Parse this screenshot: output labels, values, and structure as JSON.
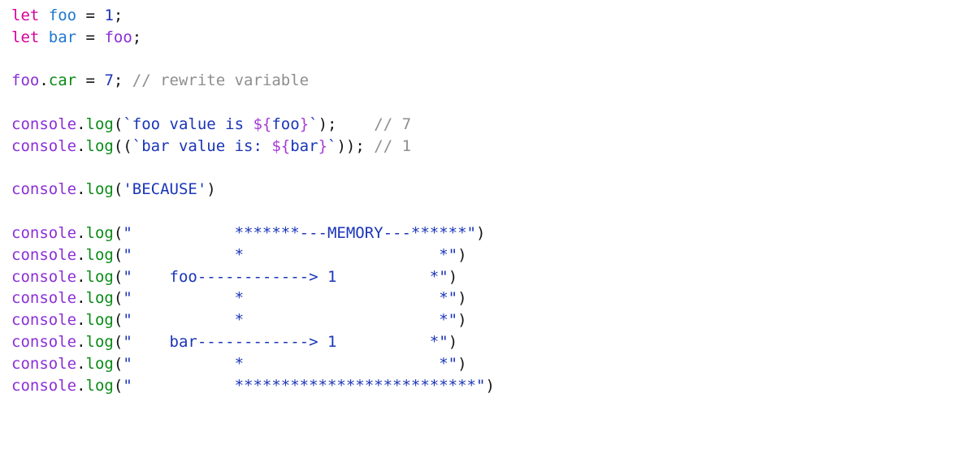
{
  "editor": {
    "background_color": "#ffffff",
    "font_size_px": 19,
    "line_height_px": 26.8
  },
  "palette": {
    "keyword": "#d6009a",
    "declared_variable": "#1f78d1",
    "object": "#8b2fd6",
    "method": "#0a8a16",
    "property": "#0a8a16",
    "string": "#1a35b8",
    "number": "#1a35b8",
    "comment": "#8e8e8e",
    "punctuation": "#141414",
    "interpolation": "#a83bd6"
  },
  "code": {
    "language": "javascript",
    "lines": [
      {
        "index": 1,
        "text": "let foo = 1;",
        "tokens": [
          {
            "t": "let",
            "c": "tok-keyword"
          },
          {
            "t": " ",
            "c": "tok-punct"
          },
          {
            "t": "foo",
            "c": "tok-declvar"
          },
          {
            "t": " = ",
            "c": "tok-operator"
          },
          {
            "t": "1",
            "c": "tok-number"
          },
          {
            "t": ";",
            "c": "tok-punct"
          }
        ]
      },
      {
        "index": 2,
        "text": "let bar = foo;",
        "tokens": [
          {
            "t": "let",
            "c": "tok-keyword"
          },
          {
            "t": " ",
            "c": "tok-punct"
          },
          {
            "t": "bar",
            "c": "tok-declvar"
          },
          {
            "t": " = ",
            "c": "tok-operator"
          },
          {
            "t": "foo",
            "c": "tok-object"
          },
          {
            "t": ";",
            "c": "tok-punct"
          }
        ]
      },
      {
        "index": 3,
        "text": "",
        "tokens": []
      },
      {
        "index": 4,
        "text": "foo.car = 7; // rewrite variable",
        "tokens": [
          {
            "t": "foo",
            "c": "tok-object"
          },
          {
            "t": ".",
            "c": "tok-punct"
          },
          {
            "t": "car",
            "c": "tok-property"
          },
          {
            "t": " = ",
            "c": "tok-operator"
          },
          {
            "t": "7",
            "c": "tok-number"
          },
          {
            "t": "; ",
            "c": "tok-punct"
          },
          {
            "t": "// rewrite variable",
            "c": "tok-comment"
          }
        ]
      },
      {
        "index": 5,
        "text": "",
        "tokens": []
      },
      {
        "index": 6,
        "text": "console.log(`foo value is ${foo}`);    // 7",
        "tokens": [
          {
            "t": "console",
            "c": "tok-object"
          },
          {
            "t": ".",
            "c": "tok-punct"
          },
          {
            "t": "log",
            "c": "tok-method"
          },
          {
            "t": "(",
            "c": "tok-punct"
          },
          {
            "t": "`foo value is ",
            "c": "tok-string"
          },
          {
            "t": "${",
            "c": "tok-interp"
          },
          {
            "t": "foo",
            "c": "tok-string"
          },
          {
            "t": "}",
            "c": "tok-interp"
          },
          {
            "t": "`",
            "c": "tok-string"
          },
          {
            "t": ");",
            "c": "tok-punct"
          },
          {
            "t": "    ",
            "c": "tok-punct"
          },
          {
            "t": "// 7",
            "c": "tok-comment"
          }
        ]
      },
      {
        "index": 7,
        "text": "console.log((`bar value is: ${bar}`)); // 1",
        "tokens": [
          {
            "t": "console",
            "c": "tok-object"
          },
          {
            "t": ".",
            "c": "tok-punct"
          },
          {
            "t": "log",
            "c": "tok-method"
          },
          {
            "t": "((",
            "c": "tok-punct"
          },
          {
            "t": "`bar value is: ",
            "c": "tok-string"
          },
          {
            "t": "${",
            "c": "tok-interp"
          },
          {
            "t": "bar",
            "c": "tok-string"
          },
          {
            "t": "}",
            "c": "tok-interp"
          },
          {
            "t": "`",
            "c": "tok-string"
          },
          {
            "t": "));",
            "c": "tok-punct"
          },
          {
            "t": " ",
            "c": "tok-punct"
          },
          {
            "t": "// 1",
            "c": "tok-comment"
          }
        ]
      },
      {
        "index": 8,
        "text": "",
        "tokens": []
      },
      {
        "index": 9,
        "text": "console.log('BECAUSE')",
        "tokens": [
          {
            "t": "console",
            "c": "tok-object"
          },
          {
            "t": ".",
            "c": "tok-punct"
          },
          {
            "t": "log",
            "c": "tok-method"
          },
          {
            "t": "(",
            "c": "tok-punct"
          },
          {
            "t": "'BECAUSE'",
            "c": "tok-string"
          },
          {
            "t": ")",
            "c": "tok-punct"
          }
        ]
      },
      {
        "index": 10,
        "text": "",
        "tokens": []
      },
      {
        "index": 11,
        "text": "console.log(\"           *******---MEMORY---******\")",
        "tokens": [
          {
            "t": "console",
            "c": "tok-object"
          },
          {
            "t": ".",
            "c": "tok-punct"
          },
          {
            "t": "log",
            "c": "tok-method"
          },
          {
            "t": "(",
            "c": "tok-punct"
          },
          {
            "t": "\"           *******---MEMORY---******\"",
            "c": "tok-ascii"
          },
          {
            "t": ")",
            "c": "tok-punct"
          }
        ]
      },
      {
        "index": 12,
        "text": "console.log(\"           *                     *\")",
        "tokens": [
          {
            "t": "console",
            "c": "tok-object"
          },
          {
            "t": ".",
            "c": "tok-punct"
          },
          {
            "t": "log",
            "c": "tok-method"
          },
          {
            "t": "(",
            "c": "tok-punct"
          },
          {
            "t": "\"           *                     *\"",
            "c": "tok-ascii"
          },
          {
            "t": ")",
            "c": "tok-punct"
          }
        ]
      },
      {
        "index": 13,
        "text": "console.log(\"    foo------------> 1          *\")",
        "tokens": [
          {
            "t": "console",
            "c": "tok-object"
          },
          {
            "t": ".",
            "c": "tok-punct"
          },
          {
            "t": "log",
            "c": "tok-method"
          },
          {
            "t": "(",
            "c": "tok-punct"
          },
          {
            "t": "\"    foo------------> 1          *\"",
            "c": "tok-ascii"
          },
          {
            "t": ")",
            "c": "tok-punct"
          }
        ]
      },
      {
        "index": 14,
        "text": "console.log(\"           *                     *\")",
        "tokens": [
          {
            "t": "console",
            "c": "tok-object"
          },
          {
            "t": ".",
            "c": "tok-punct"
          },
          {
            "t": "log",
            "c": "tok-method"
          },
          {
            "t": "(",
            "c": "tok-punct"
          },
          {
            "t": "\"           *                     *\"",
            "c": "tok-ascii"
          },
          {
            "t": ")",
            "c": "tok-punct"
          }
        ]
      },
      {
        "index": 15,
        "text": "console.log(\"           *                     *\")",
        "tokens": [
          {
            "t": "console",
            "c": "tok-object"
          },
          {
            "t": ".",
            "c": "tok-punct"
          },
          {
            "t": "log",
            "c": "tok-method"
          },
          {
            "t": "(",
            "c": "tok-punct"
          },
          {
            "t": "\"           *                     *\"",
            "c": "tok-ascii"
          },
          {
            "t": ")",
            "c": "tok-punct"
          }
        ]
      },
      {
        "index": 16,
        "text": "console.log(\"    bar------------> 1          *\")",
        "tokens": [
          {
            "t": "console",
            "c": "tok-object"
          },
          {
            "t": ".",
            "c": "tok-punct"
          },
          {
            "t": "log",
            "c": "tok-method"
          },
          {
            "t": "(",
            "c": "tok-punct"
          },
          {
            "t": "\"    bar------------> 1          *\"",
            "c": "tok-ascii"
          },
          {
            "t": ")",
            "c": "tok-punct"
          }
        ]
      },
      {
        "index": 17,
        "text": "console.log(\"           *                     *\")",
        "tokens": [
          {
            "t": "console",
            "c": "tok-object"
          },
          {
            "t": ".",
            "c": "tok-punct"
          },
          {
            "t": "log",
            "c": "tok-method"
          },
          {
            "t": "(",
            "c": "tok-punct"
          },
          {
            "t": "\"           *                     *\"",
            "c": "tok-ascii"
          },
          {
            "t": ")",
            "c": "tok-punct"
          }
        ]
      },
      {
        "index": 18,
        "text": "console.log(\"           **************************\")",
        "tokens": [
          {
            "t": "console",
            "c": "tok-object"
          },
          {
            "t": ".",
            "c": "tok-punct"
          },
          {
            "t": "log",
            "c": "tok-method"
          },
          {
            "t": "(",
            "c": "tok-punct"
          },
          {
            "t": "\"           **************************\"",
            "c": "tok-ascii"
          },
          {
            "t": ")",
            "c": "tok-punct"
          }
        ]
      }
    ]
  },
  "ascii_diagram": {
    "title": "MEMORY",
    "entries": [
      {
        "name": "foo",
        "arrow": "------------>",
        "value": "1"
      },
      {
        "name": "bar",
        "arrow": "------------>",
        "value": "1"
      }
    ]
  }
}
